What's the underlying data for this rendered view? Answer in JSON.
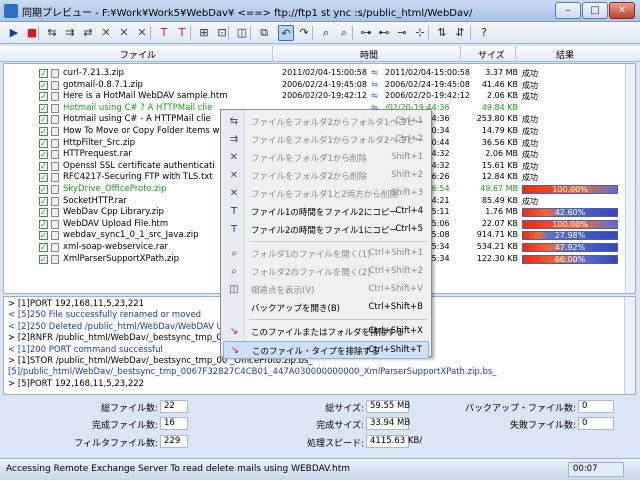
{
  "window": {
    "title": "同期プレビュー - F:¥Work¥Work5¥WebDav¥ <==> ftp://ftp1 st ync :s/public_html/WebDav/",
    "min": "–",
    "max": "□",
    "close": "✕"
  },
  "toolbar": {
    "icons": [
      "play-icon",
      "stop-icon",
      "sync-icon",
      "copy-icon",
      "sync-all-icon",
      "delete-icon",
      "delete-icon",
      "delete-both-icon",
      "time-icon",
      "time-icon",
      "open-folder-icon",
      "open-folder-icon",
      "view-icon",
      "filter-icon",
      "undo-icon",
      "undo-icon",
      "search-icon",
      "search-icon",
      "structure-icon",
      "structure-icon",
      "structure-icon",
      "structure-icon",
      "more-icon",
      "more-icon",
      "help-icon"
    ],
    "glyphs": [
      "▶",
      "■",
      "⇆",
      "⇉",
      "⇄",
      "✕",
      "✕",
      "✕",
      "T",
      "T",
      "⊞",
      "⊡",
      "◫",
      "⧉",
      "↶",
      "↷",
      "⌕",
      "⌕",
      "⊶",
      "⊷",
      "⊸",
      "⊹",
      "⇅",
      "⇵",
      "?"
    ]
  },
  "headers": {
    "file": "ファイル",
    "time": "時間",
    "size": "サイズ",
    "result": "結果"
  },
  "rows": [
    {
      "name": "curl-7.21.3.zip",
      "d1": "2011/02/04-15:00:58",
      "d2": "2011/02/04-15:00:58",
      "size": "3.37 MB",
      "res": "成功",
      "green": false
    },
    {
      "name": "gotmail-0.8.7.1.zip",
      "d1": "2006/02/24-19:45:08",
      "d2": "2006/02/24-19:45:08",
      "size": "41.46 KB",
      "res": "成功",
      "green": false
    },
    {
      "name": "Here is a HotMail WebDAV sample.htm",
      "d1": "2006/02/20-19:42:12",
      "d2": "2006/02/20-19:42:12",
      "size": "2.06 KB",
      "res": "成功",
      "green": false
    },
    {
      "name": "Hotmail using C# ? A HTTPMail clie",
      "d1": "",
      "d2": "/02/20-19:44:36",
      "size": "49.84 KB",
      "res": "",
      "green": true
    },
    {
      "name": "Hotmail using C# - A HTTPMail clie",
      "d1": "",
      "d2": "/02/20-19:44:36",
      "size": "253.80 KB",
      "res": "成功",
      "green": false
    },
    {
      "name": "How To Move or Copy Folder Items w",
      "d1": "",
      "d2": "/02/20-19:00:34",
      "size": "14.79 KB",
      "res": "成功",
      "green": false
    },
    {
      "name": "HttpFilter_Src.zip",
      "d1": "",
      "d2": "/02/24-19:30:44",
      "size": "36.56 KB",
      "res": "成功",
      "green": false
    },
    {
      "name": "HTTPrequest.rar",
      "d1": "",
      "d2": "/02/24-19:14:32",
      "size": "2.06 MB",
      "res": "成功",
      "green": false
    },
    {
      "name": "Openssl SSL certificate authenticati",
      "d1": "",
      "d2": "/02/24-19:14:32",
      "size": "15.61 KB",
      "res": "成功",
      "green": false
    },
    {
      "name": "RFC4217-Securing FTP with TLS.txt",
      "d1": "",
      "d2": "/02/24-19:16:26",
      "size": "12.84 KB",
      "res": "成功",
      "green": false
    },
    {
      "name": "SkyDrive_OfficeProto.zip",
      "d1": "",
      "d2": "/02/24-10:16:54",
      "size": "49.67 MB",
      "res": "",
      "green": true,
      "progress": 100,
      "progress_label": "100.00%"
    },
    {
      "name": "SocketHTTP.rar",
      "d1": "",
      "d2": "/02/24-19:14:21",
      "size": "85.49 KB",
      "res": "成功",
      "green": false
    },
    {
      "name": "WebDav Cpp Library.zip",
      "d1": "",
      "d2": "/02/24-19:15:11",
      "size": "1.76 MB",
      "res": "",
      "green": false,
      "progress": 42.6,
      "progress_label": "42.60%"
    },
    {
      "name": "WebDAV Upload File.htm",
      "d1": "",
      "d2": "/02/24-19:45:06",
      "size": "22.07 KB",
      "res": "",
      "green": false,
      "progress": 100,
      "progress_label": "100.00%"
    },
    {
      "name": "webdav_sync1_0_1_src_Java.zip",
      "d1": "",
      "d2": "/02/24-17:15:08",
      "size": "914.71 KB",
      "res": "",
      "green": false,
      "progress": 27.98,
      "progress_label": "27.98%"
    },
    {
      "name": "xml-soap-webservice.rar",
      "d1": "",
      "d2": "/02/24-13:55:34",
      "size": "534.21 KB",
      "res": "",
      "green": false,
      "progress": 47.92,
      "progress_label": "47.92%"
    },
    {
      "name": "XmlParserSupportXPath.zip",
      "d1": "",
      "d2": "/02/24-13:55:34",
      "size": "122.30 KB",
      "res": "",
      "green": false,
      "progress": 66.0,
      "progress_label": "66.00%"
    }
  ],
  "log": [
    {
      "text": "> [1]PORT 192,168,11,5,23,221",
      "blue": false
    },
    {
      "text": "< [5]250 File successfully renamed or moved",
      "blue": true
    },
    {
      "text": "< [2]250 Deleted /public_html/WebDav/WebDAV Up",
      "blue": true
    },
    {
      "text": "> [2]RNFR /public_html/WebDav/_bestsync_tmp_00                                          oad File.htm.bs_",
      "blue": false
    },
    {
      "text": "< [1]200 PORT command successful",
      "blue": true
    },
    {
      "text": "> [1]STOR /public_html/WebDav/_bestsync_tmp_00                                            _OfficeProto.zip.bs_",
      "blue": false
    },
    {
      "text": "  [5]/public_html/WebDav/_bestsync_tmp_0067F32827C4CB01_447A030000000000_XmlParserSupportXPath.zip.bs_",
      "blue": true
    },
    {
      "text": "> [5]PORT 192,168,11,5,23,222",
      "blue": false
    }
  ],
  "stats": {
    "total_files_label": "総ファイル数:",
    "total_files": "22",
    "done_files_label": "完成ファイル数:",
    "done_files": "16",
    "filter_files_label": "フィルタファイル数:",
    "filter_files": "229",
    "total_size_label": "総サイズ:",
    "total_size": "59.55 MB",
    "done_size_label": "完成サイズ:",
    "done_size": "33.94 MB",
    "speed_label": "処理スピード:",
    "speed": "4115.63 KB/",
    "backup_files_label": "バックアップ・ファイル数:",
    "backup_files": "0",
    "failed_files_label": "失敗ファイル数:",
    "failed_files": "0"
  },
  "status": {
    "text": "Accessing Remote Exchange Server To read  delete mails using WEBDAV.htm",
    "time": "00:07"
  },
  "menu": [
    {
      "label": "ファイルをフォルダ2からフォルダ1へコピー",
      "key": "Ctrl+1",
      "icon": "copy-icon",
      "glyph": "⇆",
      "dis": true
    },
    {
      "label": "ファイルをフォルダ1からフォルダ2へコピー",
      "key": "Ctrl+2",
      "icon": "copy-icon",
      "glyph": "⇉",
      "dis": true
    },
    {
      "label": "ファイルをフォルダ1から削除",
      "key": "Shift+1",
      "icon": "delete-icon",
      "glyph": "✕",
      "dis": true
    },
    {
      "label": "ファイルをフォルダ2から削除",
      "key": "Shift+2",
      "icon": "delete-icon",
      "glyph": "✕",
      "dis": true
    },
    {
      "label": "ファイルをフォルダ1と2両方から削除",
      "key": "Shift+3",
      "icon": "delete-both-icon",
      "glyph": "✕",
      "dis": true
    },
    {
      "label": "ファイル1の時間をファイル2にコピー",
      "key": "Ctrl+4",
      "icon": "time-icon",
      "glyph": "T",
      "dis": false
    },
    {
      "label": "ファイル2の時間をファイル1にコピー",
      "key": "Ctrl+5",
      "icon": "time-icon",
      "glyph": "T",
      "dis": false
    },
    {
      "label": "フォルダ1のファイルを開く(1)",
      "key": "Ctrl+Shift+1",
      "icon": "open-folder-icon",
      "glyph": "⌕",
      "dis": true
    },
    {
      "label": "フォルダ2のファイルを開く(2)",
      "key": "Ctrl+Shift+2",
      "icon": "open-folder-icon",
      "glyph": "⌕",
      "dis": true
    },
    {
      "label": "相違点を表示(V)",
      "key": "Ctrl+Shift+V",
      "icon": "diff-icon",
      "glyph": "◫",
      "dis": true
    },
    {
      "label": "バックアップを開き(B)",
      "key": "Ctrl+Shift+B",
      "icon": "backup-icon",
      "glyph": "",
      "dis": false
    },
    {
      "label": "このファイルまたはフォルダを排除する",
      "key": "Ctrl+Shift+X",
      "icon": "exclude-icon",
      "glyph": "↘",
      "dis": false
    },
    {
      "label": "このファイル・タイプを排除する",
      "key": "Ctrl+Shift+T",
      "icon": "exclude-type-icon",
      "glyph": "↘",
      "dis": false
    }
  ]
}
